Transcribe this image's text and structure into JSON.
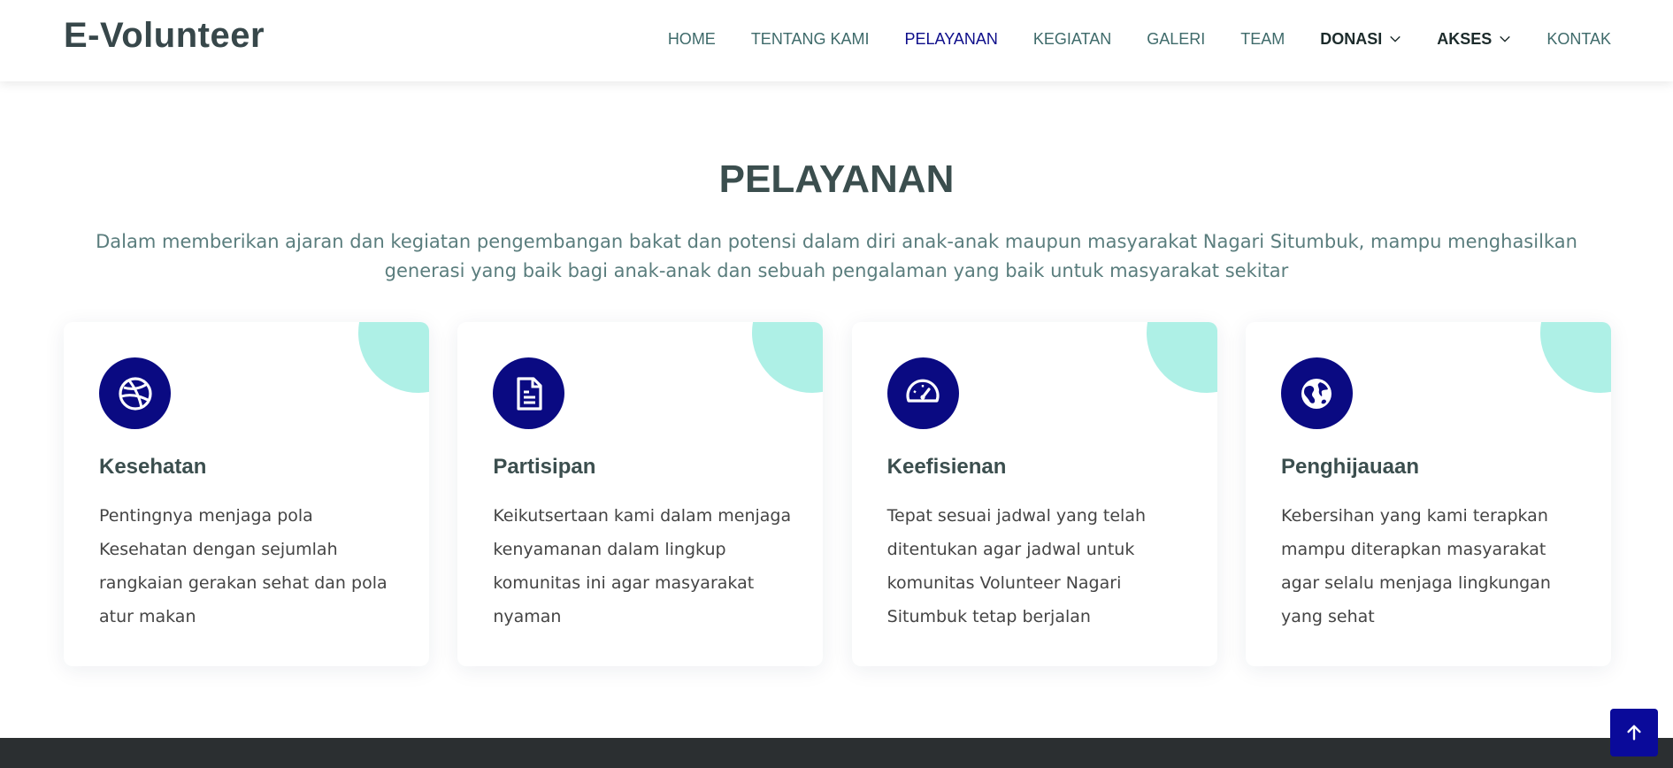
{
  "brand": {
    "logo_text": "E-Volunteer"
  },
  "nav": {
    "items": [
      {
        "label": "HOME"
      },
      {
        "label": "TENTANG KAMI"
      },
      {
        "label": "PELAYANAN"
      },
      {
        "label": "KEGIATAN"
      },
      {
        "label": "GALERI"
      },
      {
        "label": "TEAM"
      },
      {
        "label": "DONASI"
      },
      {
        "label": "AKSES"
      },
      {
        "label": "KONTAK"
      }
    ],
    "active": "PELAYANAN"
  },
  "section": {
    "title": "PELAYANAN",
    "description": "Dalam memberikan ajaran dan kegiatan pengembangan bakat dan potensi dalam diri anak-anak maupun masyarakat Nagari Situmbuk, mampu menghasilkan generasi yang baik bagi anak-anak dan sebuah pengalaman yang baik untuk masyarakat sekitar"
  },
  "cards": [
    {
      "icon": "dribbble-icon",
      "title": "Kesehatan",
      "text": "Pentingnya menjaga pola Kesehatan dengan sejumlah rangkaian gerakan sehat dan pola atur makan"
    },
    {
      "icon": "document-icon",
      "title": "Partisipan",
      "text": "Keikutsertaan kami dalam menjaga kenyamanan dalam lingkup komunitas ini agar masyarakat nyaman"
    },
    {
      "icon": "speedometer-icon",
      "title": "Keefisienan",
      "text": "Tepat sesuai jadwal yang telah ditentukan agar jadwal untuk komunitas Volunteer Nagari Situmbuk tetap berjalan"
    },
    {
      "icon": "globe-icon",
      "title": "Penghijauaan",
      "text": "Kebersihan yang kami terapkan mampu diterapkan masyarakat agar selalu menjaga lingkungan yang sehat"
    }
  ],
  "colors": {
    "primary": "#0a0a82",
    "accent": "#aef0e6",
    "heading": "#3b4e4e",
    "nav_text": "#3e6a6a",
    "nav_active": "#0d0d8a"
  },
  "back_to_top": {
    "icon": "arrow-up-icon"
  }
}
